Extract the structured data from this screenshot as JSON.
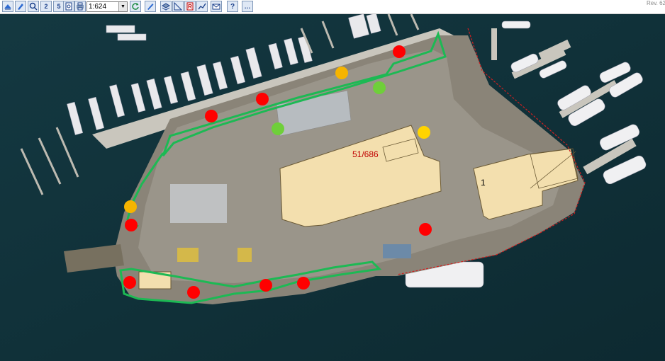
{
  "toolbar": {
    "buttons": [
      {
        "name": "layers-tool-icon"
      },
      {
        "name": "edit-tool-icon"
      },
      {
        "name": "zoom-in-icon"
      },
      {
        "name": "zoom-factor-2-button",
        "label": "2"
      },
      {
        "name": "zoom-factor-5-button",
        "label": "5"
      },
      {
        "name": "print-preview-icon"
      },
      {
        "name": "print-icon"
      }
    ],
    "scale_value": "1:624",
    "buttons_right": [
      {
        "name": "refresh-icon"
      },
      {
        "name": "pen-tool-icon"
      },
      {
        "name": "layer-stack-icon"
      },
      {
        "name": "measure-icon"
      },
      {
        "name": "report-icon"
      },
      {
        "name": "chart-icon"
      },
      {
        "name": "email-icon"
      },
      {
        "name": "help-icon"
      },
      {
        "name": "more-options-icon"
      }
    ],
    "revision_text": "Rev. 62"
  },
  "map": {
    "building_labels": {
      "main_building": "51/686",
      "east_building": "1"
    },
    "markers": {
      "red": [
        "red-marker"
      ],
      "yellow": [
        "yellow-marker"
      ],
      "green": [
        "green-marker"
      ]
    },
    "colors": {
      "red": "#ff0000",
      "yellow": "#ffc800",
      "orange": "#f5b400",
      "green": "#6fcf3a",
      "boundary": "#1db954",
      "building": "#f3dfae",
      "label_red": "#c00000"
    }
  }
}
